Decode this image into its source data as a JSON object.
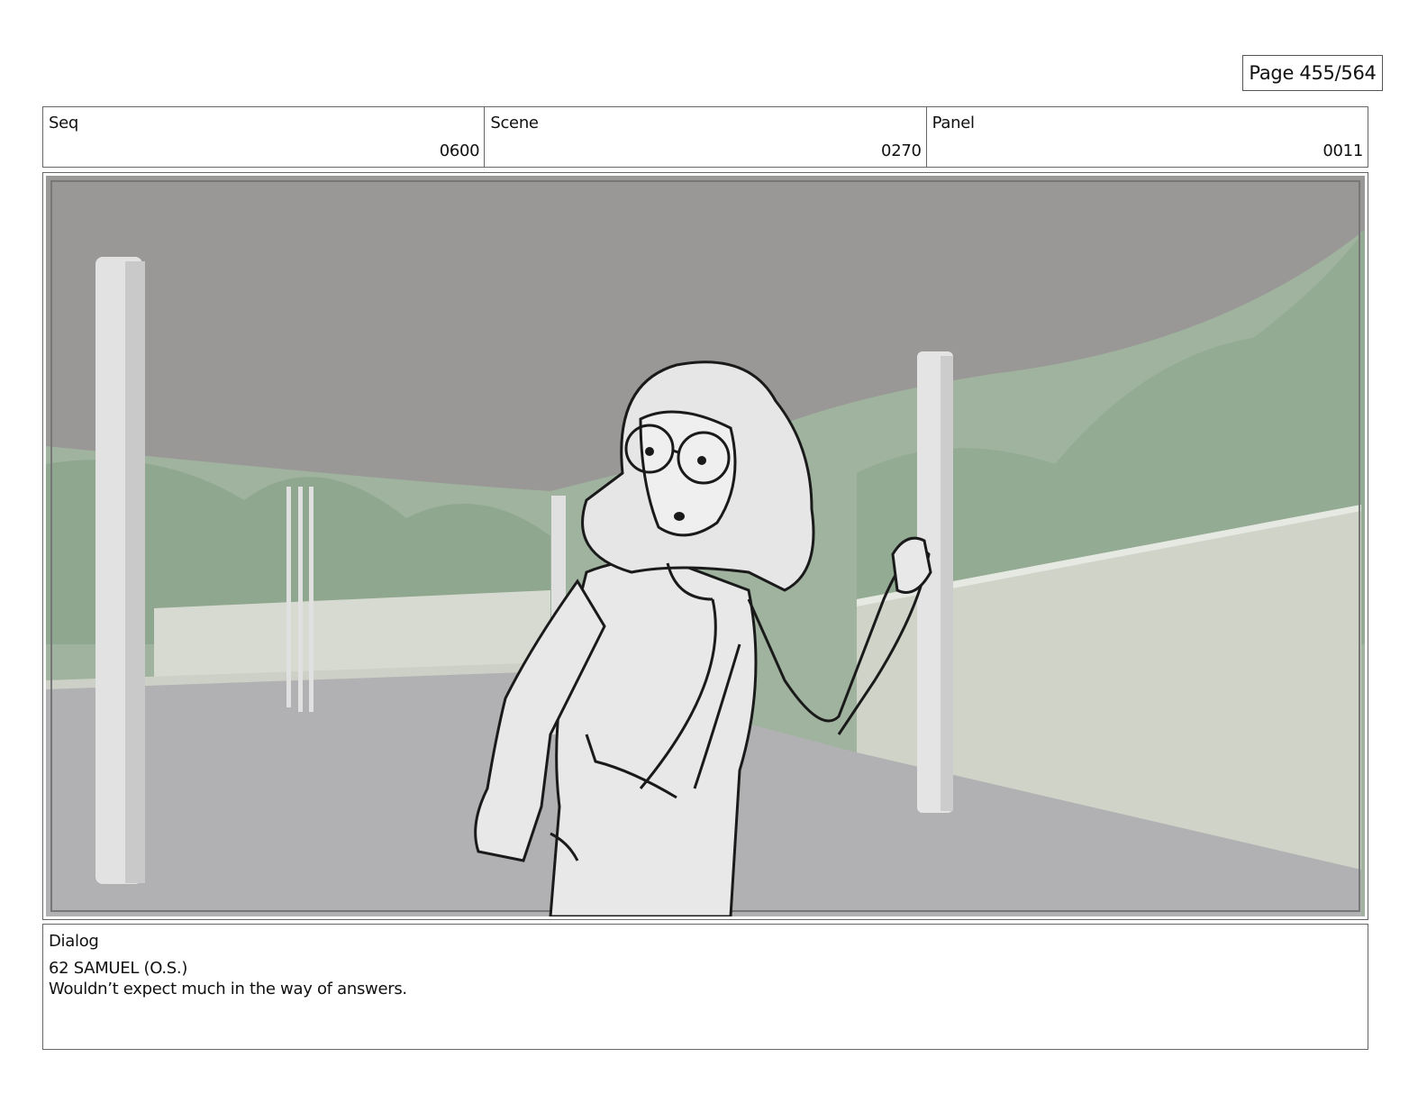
{
  "page": {
    "label": "Page 455/564"
  },
  "header": {
    "seq": {
      "label": "Seq",
      "value": "0600"
    },
    "scene": {
      "label": "Scene",
      "value": "0270"
    },
    "panel": {
      "label": "Panel",
      "value": "0011"
    }
  },
  "frame": {
    "description_icon": "storyboard-sketch-image",
    "colors": {
      "sky_green": "#9fb39f",
      "ceiling_gray": "#9a9896",
      "floor_gray": "#b1b1b3",
      "wall_light": "#cfd3c8",
      "pillar": "#e2e2e2",
      "sketch_line": "#1a1a1a",
      "character_fill": "#e8e8e8"
    }
  },
  "dialog": {
    "label": "Dialog",
    "character": "62 SAMUEL (O.S.)",
    "line": "Wouldn’t expect much in the way of answers."
  }
}
